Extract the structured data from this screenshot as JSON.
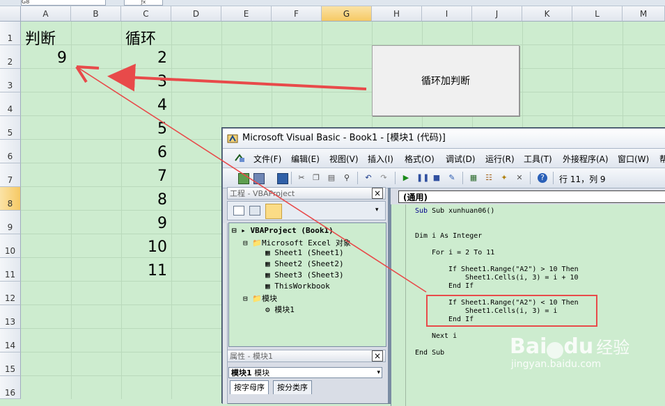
{
  "excel": {
    "name_box": "G8",
    "columns": [
      "A",
      "B",
      "C",
      "D",
      "E",
      "F",
      "G",
      "H",
      "I",
      "J",
      "K",
      "L",
      "M"
    ],
    "selected_column": "G",
    "rows": [
      "1",
      "2",
      "3",
      "4",
      "5",
      "6",
      "7",
      "8",
      "9",
      "10",
      "11",
      "12",
      "13",
      "14",
      "15",
      "16"
    ],
    "selected_row": "8",
    "cells": {
      "A1": "判断",
      "C1": "循环",
      "A2": "9",
      "C_values": [
        "2",
        "3",
        "4",
        "5",
        "6",
        "7",
        "8",
        "9",
        "10",
        "11"
      ]
    },
    "button_label": "循环加判断"
  },
  "vbe": {
    "title": "Microsoft Visual Basic - Book1 - [模块1 (代码)]",
    "menus": [
      "文件(F)",
      "编辑(E)",
      "视图(V)",
      "插入(I)",
      "格式(O)",
      "调试(D)",
      "运行(R)",
      "工具(T)",
      "外接程序(A)",
      "窗口(W)",
      "帮"
    ],
    "cursor_position": "行 11，列 9",
    "project_pane_title": "工程 - VBAProject",
    "tree": {
      "root": "VBAProject (Book1)",
      "excel_objects": "Microsoft Excel 对象",
      "sheets": [
        "Sheet1 (Sheet1)",
        "Sheet2 (Sheet2)",
        "Sheet3 (Sheet3)"
      ],
      "workbook": "ThisWorkbook",
      "modules_folder": "模块",
      "module": "模块1"
    },
    "properties_pane_title": "属性 - 模块1",
    "properties_object": "模块1",
    "properties_object_type": "模块",
    "properties_tabs": [
      "按字母序",
      "按分类序"
    ],
    "general_dropdown": "(通用)",
    "code": {
      "sub_line": "Sub xunhuan06()",
      "dim_line": "Dim i As Integer",
      "for_line": "For i = 2 To 11",
      "if1_line": "If Sheet1.Range(\"A2\") > 10 Then",
      "if1_body": "Sheet1.Cells(i, 3) = i + 10",
      "endif1": "End If",
      "if2_line": "If Sheet1.Range(\"A2\") < 10 Then",
      "if2_body": "Sheet1.Cells(i, 3) = i",
      "endif2": "End If",
      "next_line": "Next i",
      "end_sub": "End Sub"
    }
  },
  "watermark": {
    "brand_a": "Bai",
    "brand_b": "du",
    "brand_cn": "经验",
    "url": "jingyan.baidu.com"
  },
  "colors": {
    "sheet_bg": "#cdeccf",
    "annotation_red": "#e84a4a",
    "selected_header": "#f6c964"
  }
}
